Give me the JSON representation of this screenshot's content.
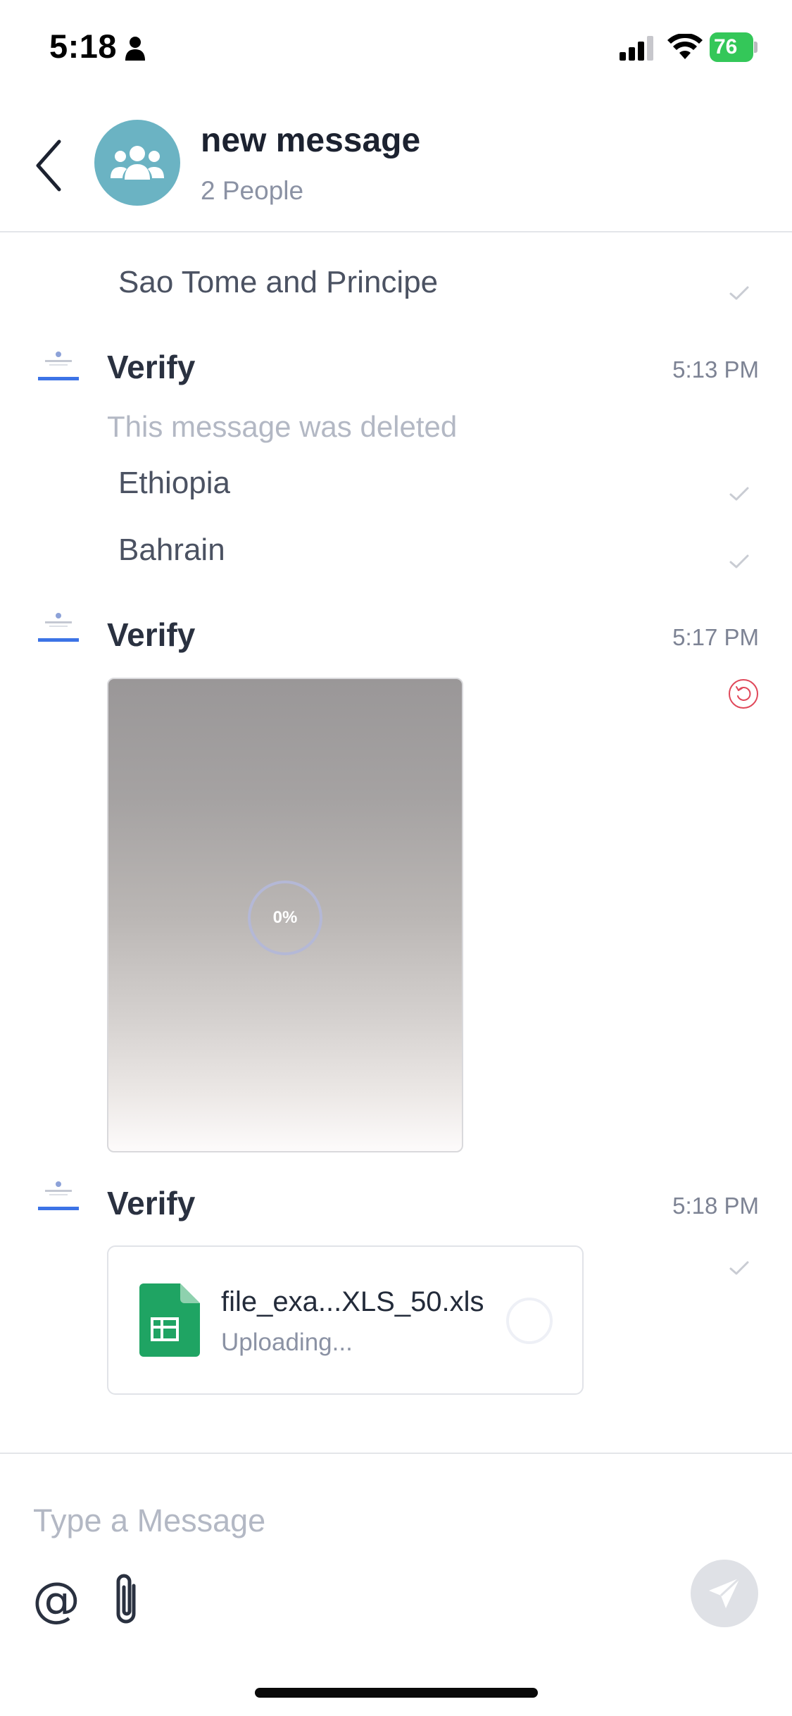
{
  "status_bar": {
    "time": "5:18",
    "battery_level": "76",
    "icons": [
      "person-icon",
      "cellular-signal-icon",
      "wifi-icon",
      "battery-charging-icon"
    ]
  },
  "header": {
    "title": "new message",
    "subtitle": "2 People",
    "back_icon": "chevron-left-icon",
    "avatar_icon": "group-icon",
    "avatar_color": "#6bb3c3"
  },
  "messages": {
    "item0": {
      "text": "Sao Tome and Principe",
      "status_icon": "check-icon"
    },
    "group1": {
      "sender": "Verify",
      "time": "5:13 PM",
      "deleted": "This message was deleted"
    },
    "item1": {
      "text": "Ethiopia",
      "status_icon": "check-icon"
    },
    "item2": {
      "text": "Bahrain",
      "status_icon": "check-icon"
    },
    "group2": {
      "sender": "Verify",
      "time": "5:17 PM",
      "progress": "0%",
      "status_icon": "retry-icon"
    },
    "group3": {
      "sender": "Verify",
      "time": "5:18 PM",
      "file_name": "file_exa...XLS_50.xls",
      "file_status": "Uploading...",
      "file_icon": "spreadsheet-icon",
      "status_icon": "check-icon"
    }
  },
  "composer": {
    "placeholder": "Type a Message",
    "mention_label": "@",
    "attach_icon": "paperclip-icon",
    "send_icon": "send-icon"
  },
  "colors": {
    "accent": "#6bb3c3",
    "file_green": "#1fa463",
    "error_red": "#e0485a"
  }
}
